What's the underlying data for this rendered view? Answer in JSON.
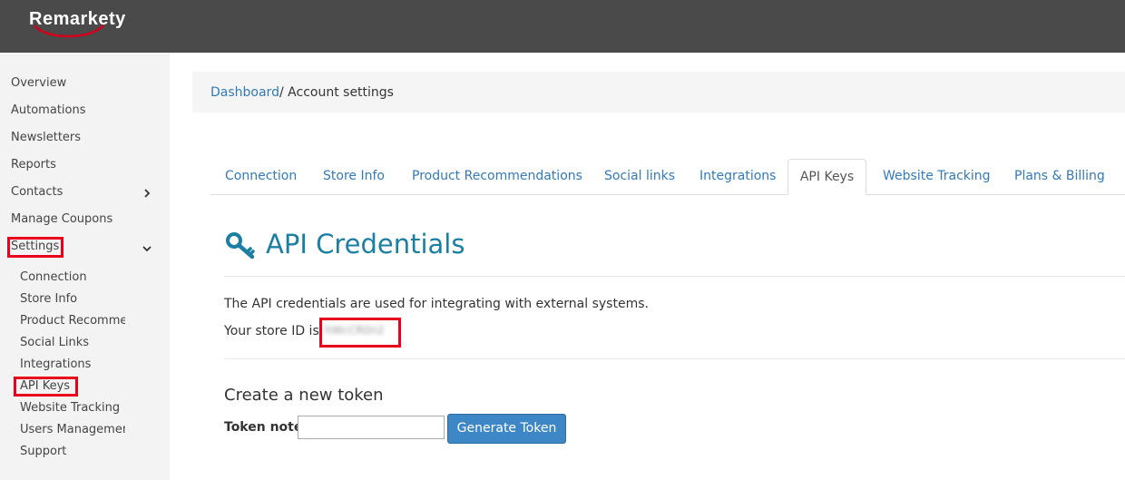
{
  "brand": {
    "logo_text": "Remarkety"
  },
  "sidebar": {
    "items": [
      {
        "label": "Overview"
      },
      {
        "label": "Automations"
      },
      {
        "label": "Newsletters"
      },
      {
        "label": "Reports"
      },
      {
        "label": "Contacts"
      },
      {
        "label": "Manage Coupons"
      },
      {
        "label": "Settings"
      }
    ],
    "settings_subitems": [
      {
        "label": "Connection"
      },
      {
        "label": "Store Info"
      },
      {
        "label": "Product Recommendations"
      },
      {
        "label": "Social Links"
      },
      {
        "label": "Integrations"
      },
      {
        "label": "API Keys"
      },
      {
        "label": "Website Tracking"
      },
      {
        "label": "Users Management"
      },
      {
        "label": "Support"
      }
    ]
  },
  "breadcrumb": {
    "link": "Dashboard",
    "current": "/ Account settings"
  },
  "tabs": [
    {
      "label": "Connection"
    },
    {
      "label": "Store Info"
    },
    {
      "label": "Product Recommendations"
    },
    {
      "label": "Social links"
    },
    {
      "label": "Integrations"
    },
    {
      "label": "API Keys"
    },
    {
      "label": "Website Tracking"
    },
    {
      "label": "Plans & Billing"
    }
  ],
  "content": {
    "title": "API Credentials",
    "description": "The API credentials are used for integrating with external systems.",
    "store_id_label": "Your store ID is:",
    "store_id_value": "hWcCR0n2",
    "create_token_heading": "Create a new token",
    "token_note_label": "Token note:",
    "token_note_value": "",
    "generate_button": "Generate Token"
  },
  "colors": {
    "accent": "#337ab7",
    "heading": "#1a7fa3",
    "topbar": "#4a4a4a",
    "highlight": "#e8001c"
  }
}
